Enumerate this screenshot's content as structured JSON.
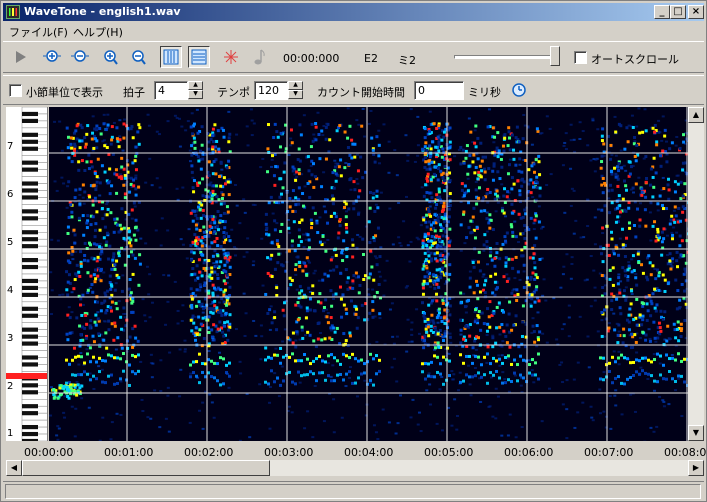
{
  "window": {
    "title": "WaveTone - english1.wav"
  },
  "title_buttons": {
    "minimize": "_",
    "maximize": "□",
    "close": "×"
  },
  "menu": [
    {
      "label": "ファイル(F)"
    },
    {
      "label": "ヘルプ(H)"
    }
  ],
  "toolbar1": {
    "time": "00:00:000",
    "note1": "E2",
    "note2": "ミ2",
    "autoscroll_label": "オートスクロール",
    "autoscroll_checked": false,
    "volume_level": 1.0
  },
  "toolbar2": {
    "measure_label": "小節単位で表示",
    "measure_checked": false,
    "beat_label": "拍子",
    "beat_value": "4",
    "tempo_label": "テンポ",
    "tempo_value": "120",
    "count_start_label": "カウント開始時間",
    "count_start_value": "0",
    "ms_label": "ミリ秒"
  },
  "piano": {
    "octave_labels": [
      "7",
      "6",
      "5",
      "4",
      "3",
      "2",
      "1"
    ],
    "highlighted_note": "E2"
  },
  "time_axis": {
    "labels": [
      "00:00:00",
      "00:01:00",
      "00:02:00",
      "00:03:00",
      "00:04:00",
      "00:05:00",
      "00:06:00",
      "00:07:00",
      "00:08:0"
    ]
  },
  "colors": {
    "title_start": "#0a246a",
    "title_end": "#a6caf0",
    "spectrogram_bg": "#000018",
    "highlight_key": "#ff2020"
  }
}
